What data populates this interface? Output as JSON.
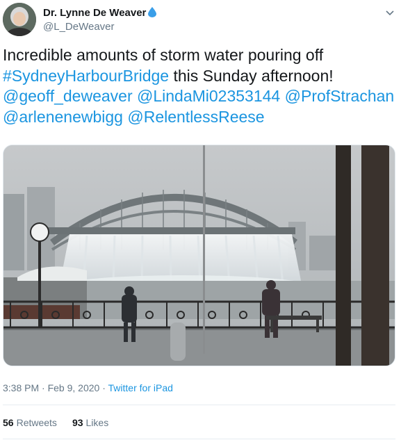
{
  "author": {
    "name": "Dr. Lynne De Weaver",
    "handle": "@L_DeWeaver",
    "name_emoji": "water-drop-icon"
  },
  "tweet": {
    "lines": [
      [
        {
          "t": "Incredible amounts of storm water pouring off",
          "link": false
        }
      ],
      [
        {
          "t": "#SydneyHarbourBridge",
          "link": true
        },
        {
          "t": " this Sunday afternoon!",
          "link": false
        }
      ],
      [
        {
          "t": "@geoff_deweaver",
          "link": true
        },
        {
          "t": " ",
          "link": false
        },
        {
          "t": "@LindaMi02353144",
          "link": true
        },
        {
          "t": " ",
          "link": false
        },
        {
          "t": "@ProfStrachan",
          "link": true
        }
      ],
      [
        {
          "t": "@arlenenewbigg",
          "link": true
        },
        {
          "t": " ",
          "link": false
        },
        {
          "t": "@RelentlessReese",
          "link": true
        }
      ]
    ]
  },
  "meta": {
    "time": "3:38 PM",
    "sep": " · ",
    "date": "Feb 9, 2020",
    "source": "Twitter for iPad"
  },
  "stats": {
    "retweets_count": "56",
    "retweets_label": "Retweets",
    "likes_count": "93",
    "likes_label": "Likes"
  },
  "colors": {
    "link": "#1b95e0",
    "secondary_text": "#657786",
    "primary_text": "#14171a"
  }
}
